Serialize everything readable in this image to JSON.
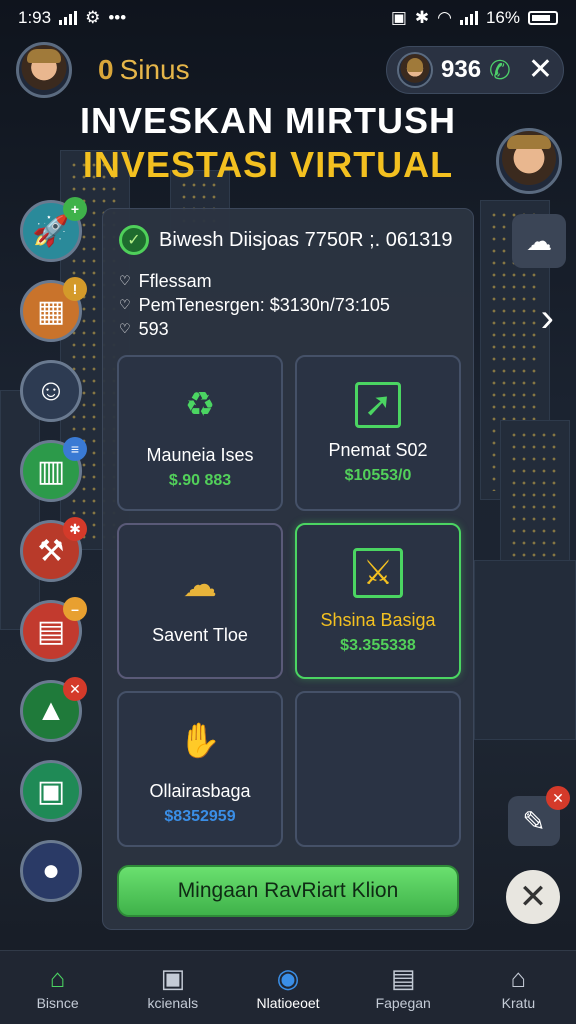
{
  "status_bar": {
    "time": "1:93",
    "battery": "16%"
  },
  "header": {
    "coins_value": "0",
    "coins_label": "Sinus",
    "score": "936",
    "title_line1": "INVESKAN MIRTUSH",
    "title_line2": "INVESTASI VIRTUAL"
  },
  "panel": {
    "header_text": "Biwesh Diisjoas 7750R ;. 061319",
    "info": [
      "Fflessam",
      "PemTenesrgen: $3130n/73:105",
      "593"
    ],
    "cards": [
      {
        "name": "Mauneia Ises",
        "value": "$.90 883",
        "value_color": "#52d05a",
        "icon": "recycle-check-icon"
      },
      {
        "name": "Pnemat S02",
        "value": "$10553/0",
        "value_color": "#52d05a",
        "icon": "growth-arrow-icon"
      },
      {
        "name": "Savent Tloe",
        "value": "",
        "value_color": "",
        "icon": "cloud-server-icon"
      },
      {
        "name": "Shsina Basiga",
        "value": "$3.355338",
        "value_color": "#52d05a",
        "icon": "cross-tools-icon",
        "name_color": "#f3c020"
      },
      {
        "name": "Ollairasbaga",
        "value": "$8352959",
        "value_color": "#3a8ee6",
        "icon": "hand-coin-icon"
      },
      {
        "name": "",
        "value": "",
        "value_color": "",
        "icon": ""
      }
    ],
    "cta_label": "Mingaan RavRiart Klion"
  },
  "bottom_nav": [
    {
      "label": "Bisnce",
      "icon": "home-icon"
    },
    {
      "label": "kcienals",
      "icon": "badge-icon"
    },
    {
      "label": "Nlatioeoet",
      "icon": "globe-icon"
    },
    {
      "label": "Fapegan",
      "icon": "chat-icon"
    },
    {
      "label": "Kratu",
      "icon": "house-store-icon"
    }
  ]
}
